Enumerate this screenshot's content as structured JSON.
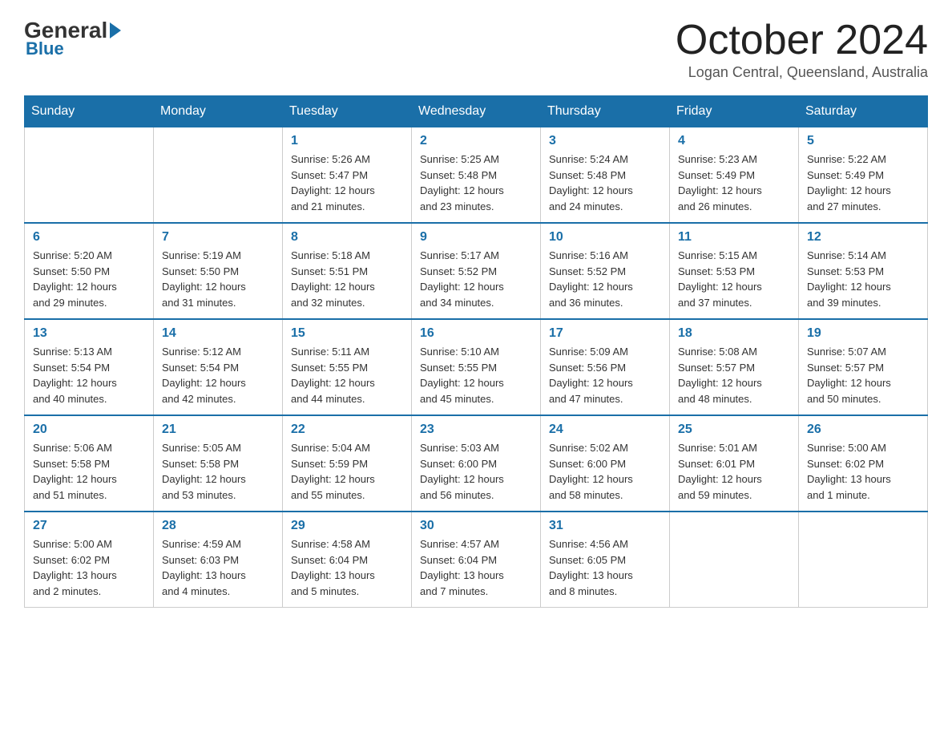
{
  "header": {
    "logo_general": "General",
    "logo_blue": "Blue",
    "month_title": "October 2024",
    "location": "Logan Central, Queensland, Australia"
  },
  "weekdays": [
    "Sunday",
    "Monday",
    "Tuesday",
    "Wednesday",
    "Thursday",
    "Friday",
    "Saturday"
  ],
  "weeks": [
    [
      {
        "day": "",
        "info": ""
      },
      {
        "day": "",
        "info": ""
      },
      {
        "day": "1",
        "info": "Sunrise: 5:26 AM\nSunset: 5:47 PM\nDaylight: 12 hours\nand 21 minutes."
      },
      {
        "day": "2",
        "info": "Sunrise: 5:25 AM\nSunset: 5:48 PM\nDaylight: 12 hours\nand 23 minutes."
      },
      {
        "day": "3",
        "info": "Sunrise: 5:24 AM\nSunset: 5:48 PM\nDaylight: 12 hours\nand 24 minutes."
      },
      {
        "day": "4",
        "info": "Sunrise: 5:23 AM\nSunset: 5:49 PM\nDaylight: 12 hours\nand 26 minutes."
      },
      {
        "day": "5",
        "info": "Sunrise: 5:22 AM\nSunset: 5:49 PM\nDaylight: 12 hours\nand 27 minutes."
      }
    ],
    [
      {
        "day": "6",
        "info": "Sunrise: 5:20 AM\nSunset: 5:50 PM\nDaylight: 12 hours\nand 29 minutes."
      },
      {
        "day": "7",
        "info": "Sunrise: 5:19 AM\nSunset: 5:50 PM\nDaylight: 12 hours\nand 31 minutes."
      },
      {
        "day": "8",
        "info": "Sunrise: 5:18 AM\nSunset: 5:51 PM\nDaylight: 12 hours\nand 32 minutes."
      },
      {
        "day": "9",
        "info": "Sunrise: 5:17 AM\nSunset: 5:52 PM\nDaylight: 12 hours\nand 34 minutes."
      },
      {
        "day": "10",
        "info": "Sunrise: 5:16 AM\nSunset: 5:52 PM\nDaylight: 12 hours\nand 36 minutes."
      },
      {
        "day": "11",
        "info": "Sunrise: 5:15 AM\nSunset: 5:53 PM\nDaylight: 12 hours\nand 37 minutes."
      },
      {
        "day": "12",
        "info": "Sunrise: 5:14 AM\nSunset: 5:53 PM\nDaylight: 12 hours\nand 39 minutes."
      }
    ],
    [
      {
        "day": "13",
        "info": "Sunrise: 5:13 AM\nSunset: 5:54 PM\nDaylight: 12 hours\nand 40 minutes."
      },
      {
        "day": "14",
        "info": "Sunrise: 5:12 AM\nSunset: 5:54 PM\nDaylight: 12 hours\nand 42 minutes."
      },
      {
        "day": "15",
        "info": "Sunrise: 5:11 AM\nSunset: 5:55 PM\nDaylight: 12 hours\nand 44 minutes."
      },
      {
        "day": "16",
        "info": "Sunrise: 5:10 AM\nSunset: 5:55 PM\nDaylight: 12 hours\nand 45 minutes."
      },
      {
        "day": "17",
        "info": "Sunrise: 5:09 AM\nSunset: 5:56 PM\nDaylight: 12 hours\nand 47 minutes."
      },
      {
        "day": "18",
        "info": "Sunrise: 5:08 AM\nSunset: 5:57 PM\nDaylight: 12 hours\nand 48 minutes."
      },
      {
        "day": "19",
        "info": "Sunrise: 5:07 AM\nSunset: 5:57 PM\nDaylight: 12 hours\nand 50 minutes."
      }
    ],
    [
      {
        "day": "20",
        "info": "Sunrise: 5:06 AM\nSunset: 5:58 PM\nDaylight: 12 hours\nand 51 minutes."
      },
      {
        "day": "21",
        "info": "Sunrise: 5:05 AM\nSunset: 5:58 PM\nDaylight: 12 hours\nand 53 minutes."
      },
      {
        "day": "22",
        "info": "Sunrise: 5:04 AM\nSunset: 5:59 PM\nDaylight: 12 hours\nand 55 minutes."
      },
      {
        "day": "23",
        "info": "Sunrise: 5:03 AM\nSunset: 6:00 PM\nDaylight: 12 hours\nand 56 minutes."
      },
      {
        "day": "24",
        "info": "Sunrise: 5:02 AM\nSunset: 6:00 PM\nDaylight: 12 hours\nand 58 minutes."
      },
      {
        "day": "25",
        "info": "Sunrise: 5:01 AM\nSunset: 6:01 PM\nDaylight: 12 hours\nand 59 minutes."
      },
      {
        "day": "26",
        "info": "Sunrise: 5:00 AM\nSunset: 6:02 PM\nDaylight: 13 hours\nand 1 minute."
      }
    ],
    [
      {
        "day": "27",
        "info": "Sunrise: 5:00 AM\nSunset: 6:02 PM\nDaylight: 13 hours\nand 2 minutes."
      },
      {
        "day": "28",
        "info": "Sunrise: 4:59 AM\nSunset: 6:03 PM\nDaylight: 13 hours\nand 4 minutes."
      },
      {
        "day": "29",
        "info": "Sunrise: 4:58 AM\nSunset: 6:04 PM\nDaylight: 13 hours\nand 5 minutes."
      },
      {
        "day": "30",
        "info": "Sunrise: 4:57 AM\nSunset: 6:04 PM\nDaylight: 13 hours\nand 7 minutes."
      },
      {
        "day": "31",
        "info": "Sunrise: 4:56 AM\nSunset: 6:05 PM\nDaylight: 13 hours\nand 8 minutes."
      },
      {
        "day": "",
        "info": ""
      },
      {
        "day": "",
        "info": ""
      }
    ]
  ]
}
